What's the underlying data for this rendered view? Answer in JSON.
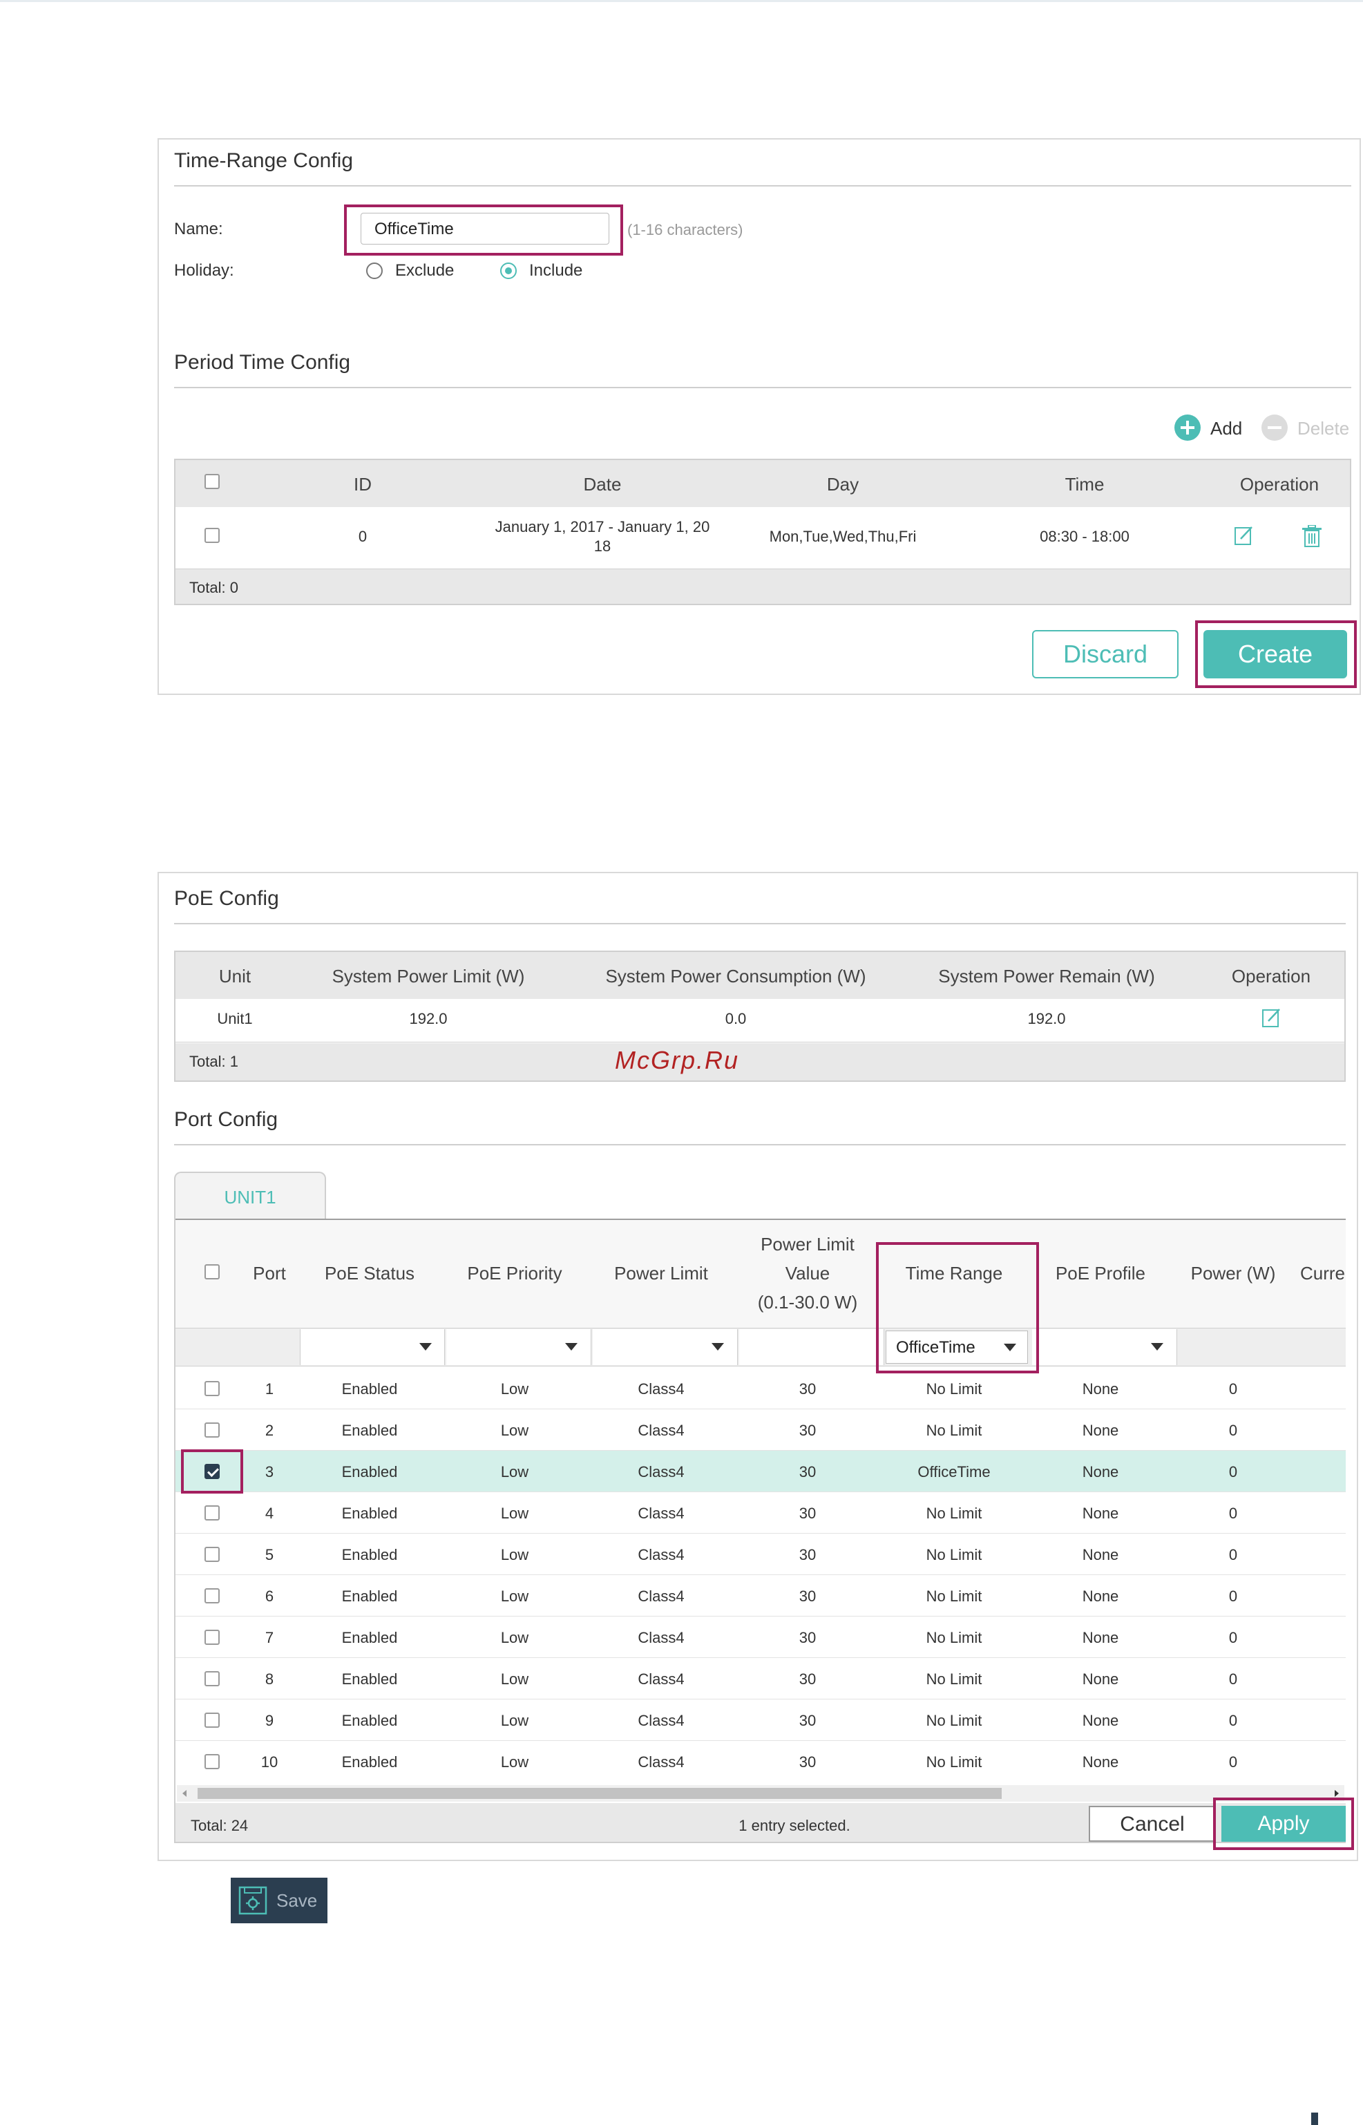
{
  "time_range": {
    "title": "Time-Range Config",
    "name_label": "Name:",
    "name_value": "OfficeTime",
    "name_hint": "(1-16 characters)",
    "holiday_label": "Holiday:",
    "exclude_label": "Exclude",
    "include_label": "Include",
    "period_title": "Period Time Config",
    "add_label": "Add",
    "delete_label": "Delete",
    "headers": [
      "ID",
      "Date",
      "Day",
      "Time",
      "Operation"
    ],
    "row": {
      "id": "0",
      "date_line1": "January 1, 2017 - January 1, 20",
      "date_line2": "18",
      "day": "Mon,Tue,Wed,Thu,Fri",
      "time": "08:30 - 18:00"
    },
    "total": "Total: 0",
    "discard_label": "Discard",
    "create_label": "Create"
  },
  "poe_config": {
    "title": "PoE Config",
    "headers": [
      "Unit",
      "System Power Limit (W)",
      "System Power Consumption (W)",
      "System Power Remain (W)",
      "Operation"
    ],
    "row": {
      "unit": "Unit1",
      "limit": "192.0",
      "consumption": "0.0",
      "remain": "192.0"
    },
    "total": "Total: 1"
  },
  "watermark": "McGrp.Ru",
  "port_config": {
    "title": "Port Config",
    "tab": "UNIT1",
    "headers": {
      "port": "Port",
      "poe_status": "PoE Status",
      "poe_priority": "PoE Priority",
      "power_limit": "Power Limit",
      "plv_1": "Power Limit",
      "plv_2": "Value",
      "plv_3": "(0.1-30.0 W)",
      "time_range": "Time Range",
      "poe_profile": "PoE Profile",
      "power": "Power (W)",
      "current": "Curre"
    },
    "filter_time_range": "OfficeTime",
    "rows": [
      {
        "port": "1",
        "status": "Enabled",
        "priority": "Low",
        "limit": "Class4",
        "value": "30",
        "range": "No Limit",
        "profile": "None",
        "power": "0",
        "checked": false
      },
      {
        "port": "2",
        "status": "Enabled",
        "priority": "Low",
        "limit": "Class4",
        "value": "30",
        "range": "No Limit",
        "profile": "None",
        "power": "0",
        "checked": false
      },
      {
        "port": "3",
        "status": "Enabled",
        "priority": "Low",
        "limit": "Class4",
        "value": "30",
        "range": "OfficeTime",
        "profile": "None",
        "power": "0",
        "checked": true
      },
      {
        "port": "4",
        "status": "Enabled",
        "priority": "Low",
        "limit": "Class4",
        "value": "30",
        "range": "No Limit",
        "profile": "None",
        "power": "0",
        "checked": false
      },
      {
        "port": "5",
        "status": "Enabled",
        "priority": "Low",
        "limit": "Class4",
        "value": "30",
        "range": "No Limit",
        "profile": "None",
        "power": "0",
        "checked": false
      },
      {
        "port": "6",
        "status": "Enabled",
        "priority": "Low",
        "limit": "Class4",
        "value": "30",
        "range": "No Limit",
        "profile": "None",
        "power": "0",
        "checked": false
      },
      {
        "port": "7",
        "status": "Enabled",
        "priority": "Low",
        "limit": "Class4",
        "value": "30",
        "range": "No Limit",
        "profile": "None",
        "power": "0",
        "checked": false
      },
      {
        "port": "8",
        "status": "Enabled",
        "priority": "Low",
        "limit": "Class4",
        "value": "30",
        "range": "No Limit",
        "profile": "None",
        "power": "0",
        "checked": false
      },
      {
        "port": "9",
        "status": "Enabled",
        "priority": "Low",
        "limit": "Class4",
        "value": "30",
        "range": "No Limit",
        "profile": "None",
        "power": "0",
        "checked": false
      },
      {
        "port": "10",
        "status": "Enabled",
        "priority": "Low",
        "limit": "Class4",
        "value": "30",
        "range": "No Limit",
        "profile": "None",
        "power": "0",
        "checked": false
      }
    ],
    "total": "Total: 24",
    "selected": "1 entry selected.",
    "cancel_label": "Cancel",
    "apply_label": "Apply"
  },
  "save_label": "Save",
  "colors": {
    "accent": "#4dbdb5",
    "highlight_border": "#a3205f",
    "selected_row": "#d4f0ea",
    "save_button": "#2b3e50"
  }
}
